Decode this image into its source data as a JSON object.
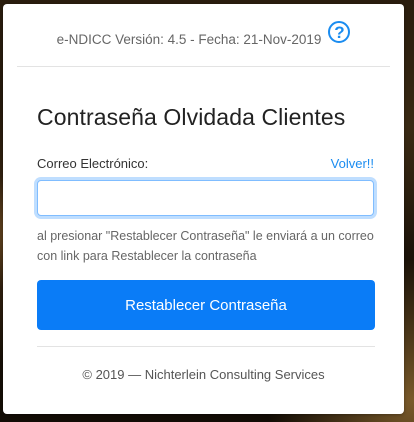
{
  "header": {
    "version_text": "e-NDICC Versión: 4.5 - Fecha: 21-Nov-2019",
    "help_icon": "question-circle-icon",
    "help_glyph": "?"
  },
  "form": {
    "title": "Contraseña Olvidada Clientes",
    "email_label": "Correo Electrónico:",
    "back_link": "Volver!!",
    "email_value": "",
    "help_text": "al presionar \"Restablecer Contraseña\" le enviará a un correo con link para Restablecer la contraseña",
    "submit_label": "Restablecer Contraseña"
  },
  "footer": {
    "text": "© 2019 — Nichterlein Consulting Services"
  },
  "colors": {
    "accent": "#0a7cf7",
    "link": "#1a8cf0",
    "focus_border": "#80bdff"
  }
}
